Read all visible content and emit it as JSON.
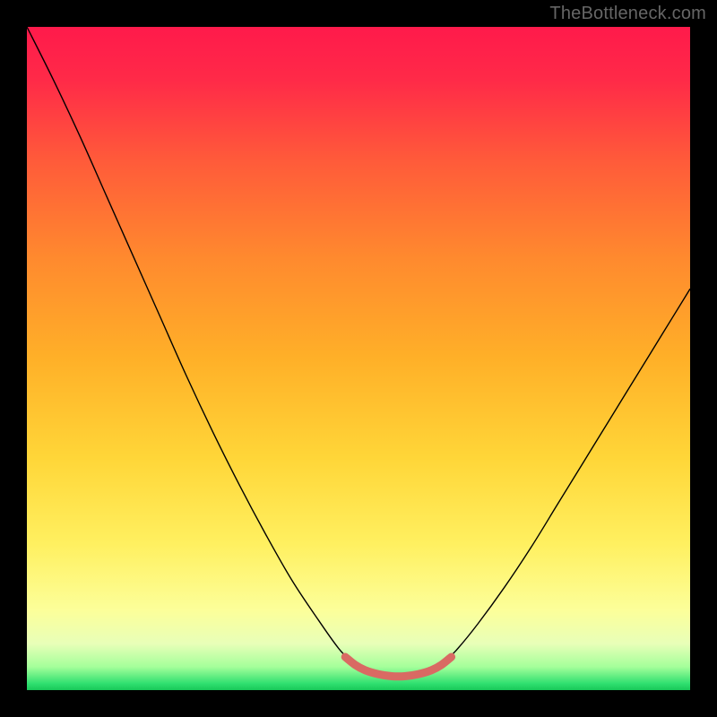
{
  "watermark": "TheBottleneck.com",
  "chart_data": {
    "type": "line",
    "title": "",
    "xlabel": "",
    "ylabel": "",
    "xlim": [
      0,
      100
    ],
    "ylim": [
      0,
      100
    ],
    "background_gradient": {
      "stops": [
        {
          "offset": 0.0,
          "color": "#ff1a4b"
        },
        {
          "offset": 0.08,
          "color": "#ff2a48"
        },
        {
          "offset": 0.2,
          "color": "#ff5a3a"
        },
        {
          "offset": 0.35,
          "color": "#ff8a2e"
        },
        {
          "offset": 0.5,
          "color": "#ffb028"
        },
        {
          "offset": 0.65,
          "color": "#ffd638"
        },
        {
          "offset": 0.78,
          "color": "#fff060"
        },
        {
          "offset": 0.88,
          "color": "#fcff9a"
        },
        {
          "offset": 0.93,
          "color": "#e8ffb8"
        },
        {
          "offset": 0.965,
          "color": "#a4ff9a"
        },
        {
          "offset": 0.99,
          "color": "#30e070"
        },
        {
          "offset": 1.0,
          "color": "#18c858"
        }
      ]
    },
    "series": [
      {
        "name": "bottleneck-curve",
        "stroke": "#000000",
        "stroke_width": 1.4,
        "points": [
          {
            "x": 0.0,
            "y": 100.0
          },
          {
            "x": 4.0,
            "y": 92.0
          },
          {
            "x": 8.0,
            "y": 83.5
          },
          {
            "x": 12.0,
            "y": 74.5
          },
          {
            "x": 16.0,
            "y": 65.5
          },
          {
            "x": 20.0,
            "y": 56.5
          },
          {
            "x": 24.0,
            "y": 47.5
          },
          {
            "x": 28.0,
            "y": 39.0
          },
          {
            "x": 32.0,
            "y": 31.0
          },
          {
            "x": 36.0,
            "y": 23.5
          },
          {
            "x": 40.0,
            "y": 16.5
          },
          {
            "x": 44.0,
            "y": 10.5
          },
          {
            "x": 47.0,
            "y": 6.3
          },
          {
            "x": 49.0,
            "y": 4.3
          },
          {
            "x": 51.0,
            "y": 3.0
          },
          {
            "x": 53.0,
            "y": 2.3
          },
          {
            "x": 55.0,
            "y": 2.0
          },
          {
            "x": 57.0,
            "y": 2.0
          },
          {
            "x": 59.0,
            "y": 2.3
          },
          {
            "x": 61.0,
            "y": 3.0
          },
          {
            "x": 63.0,
            "y": 4.3
          },
          {
            "x": 65.0,
            "y": 6.3
          },
          {
            "x": 68.0,
            "y": 10.0
          },
          {
            "x": 72.0,
            "y": 15.5
          },
          {
            "x": 76.0,
            "y": 21.5
          },
          {
            "x": 80.0,
            "y": 28.0
          },
          {
            "x": 84.0,
            "y": 34.5
          },
          {
            "x": 88.0,
            "y": 41.0
          },
          {
            "x": 92.0,
            "y": 47.5
          },
          {
            "x": 96.0,
            "y": 54.0
          },
          {
            "x": 100.0,
            "y": 60.5
          }
        ]
      },
      {
        "name": "valley-highlight",
        "stroke": "#d96a63",
        "stroke_width": 9,
        "stroke_linecap": "round",
        "points": [
          {
            "x": 48.0,
            "y": 5.0
          },
          {
            "x": 49.5,
            "y": 3.8
          },
          {
            "x": 51.0,
            "y": 3.0
          },
          {
            "x": 53.0,
            "y": 2.4
          },
          {
            "x": 55.0,
            "y": 2.1
          },
          {
            "x": 57.0,
            "y": 2.1
          },
          {
            "x": 59.0,
            "y": 2.4
          },
          {
            "x": 61.0,
            "y": 3.0
          },
          {
            "x": 62.5,
            "y": 3.8
          },
          {
            "x": 64.0,
            "y": 5.0
          }
        ]
      }
    ]
  }
}
